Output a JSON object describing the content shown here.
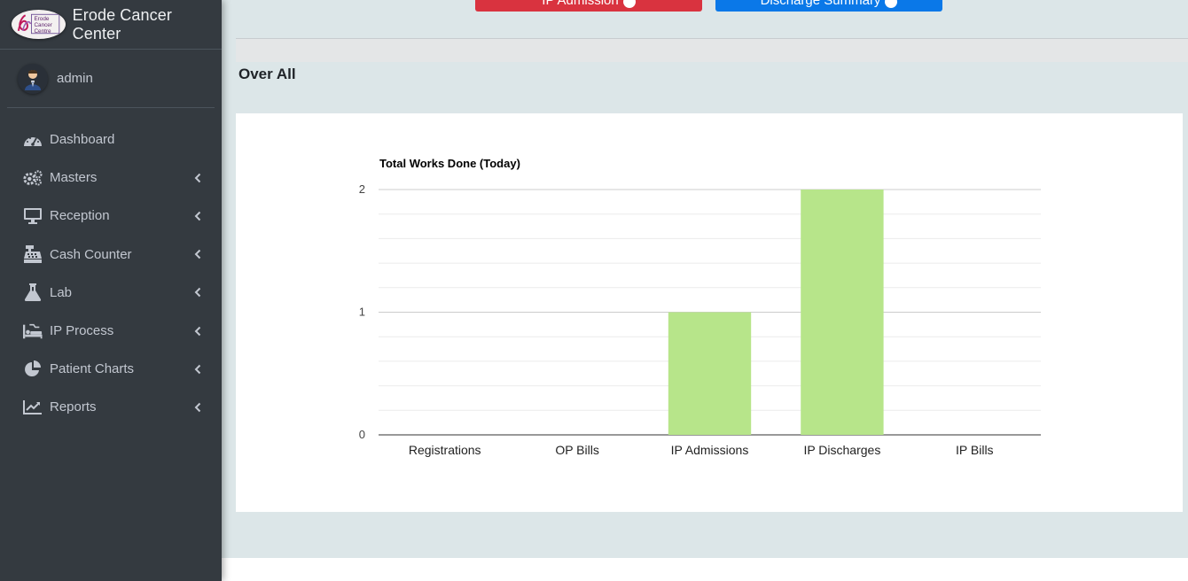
{
  "brand": {
    "title": "Erode Cancer Center",
    "logo_text": [
      "Erode",
      "Cancer",
      "Centre"
    ]
  },
  "user": {
    "name": "admin"
  },
  "nav": [
    {
      "label": "Dashboard",
      "icon": "tachometer-icon",
      "has_caret": false
    },
    {
      "label": "Masters",
      "icon": "cogs-icon",
      "has_caret": true
    },
    {
      "label": "Reception",
      "icon": "desktop-icon",
      "has_caret": true
    },
    {
      "label": "Cash Counter",
      "icon": "cash-register-icon",
      "has_caret": true
    },
    {
      "label": "Lab",
      "icon": "flask-icon",
      "has_caret": true
    },
    {
      "label": "IP Process",
      "icon": "procedures-icon",
      "has_caret": true
    },
    {
      "label": "Patient Charts",
      "icon": "pie-chart-icon",
      "has_caret": true
    },
    {
      "label": "Reports",
      "icon": "line-chart-icon",
      "has_caret": true
    }
  ],
  "actions": {
    "ip_admission_label": "IP Admission",
    "discharge_summary_label": "Discharge Summary"
  },
  "section": {
    "title": "Over All"
  },
  "colors": {
    "sidebar_bg": "#343a40",
    "bar": "#b7e58a",
    "btn_red": "#d9333f",
    "btn_blue": "#0a78e8"
  },
  "chart_data": {
    "type": "bar",
    "title": "Total Works Done (Today)",
    "categories": [
      "Registrations",
      "OP Bills",
      "IP Admissions",
      "IP Discharges",
      "IP Bills"
    ],
    "values": [
      0,
      0,
      1,
      2,
      0
    ],
    "ylim": [
      0,
      2
    ],
    "yticks": [
      0,
      1,
      2
    ],
    "xlabel": "",
    "ylabel": "",
    "grid": true,
    "legend": "none"
  }
}
